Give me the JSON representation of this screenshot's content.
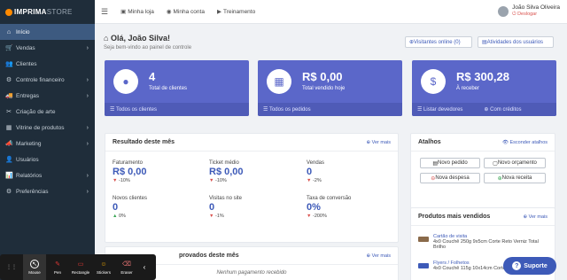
{
  "brand": {
    "name1": "IMPRIMA",
    "name2": "STORE"
  },
  "sidebar": {
    "items": [
      {
        "icon": "⌂",
        "label": "Início",
        "chev": ""
      },
      {
        "icon": "🛒",
        "label": "Vendas",
        "chev": "›"
      },
      {
        "icon": "👥",
        "label": "Clientes",
        "chev": ""
      },
      {
        "icon": "⚙",
        "label": "Controle financeiro",
        "chev": "›"
      },
      {
        "icon": "🚚",
        "label": "Entregas",
        "chev": "›"
      },
      {
        "icon": "✂",
        "label": "Criação de arte",
        "chev": ""
      },
      {
        "icon": "▦",
        "label": "Vitrine de produtos",
        "chev": "›"
      },
      {
        "icon": "📣",
        "label": "Marketing",
        "chev": "›"
      },
      {
        "icon": "👤",
        "label": "Usuários",
        "chev": ""
      },
      {
        "icon": "📊",
        "label": "Relatórios",
        "chev": "›"
      },
      {
        "icon": "⚙",
        "label": "Preferências",
        "chev": "›"
      }
    ]
  },
  "topbar": {
    "links": [
      "Minha loja",
      "Minha conta",
      "Treinamento"
    ],
    "user_name": "João Silva Oliveira",
    "logout": "Deslogar"
  },
  "greeting": {
    "title": "Olá, João Silva!",
    "subtitle": "Seja bem-vindo ao painel de controle"
  },
  "header_buttons": {
    "visitors": "Visitantes online (0)",
    "activities": "Atividades dos usuários"
  },
  "cards": [
    {
      "value": "4",
      "label": "Total de clientes",
      "footer": [
        "Todos os clientes"
      ]
    },
    {
      "value": "R$ 0,00",
      "label": "Total vendido hoje",
      "footer": [
        "Todos os pedidos"
      ]
    },
    {
      "value": "R$ 300,28",
      "label": "À receber",
      "footer": [
        "Listar devedores",
        "Com créditos"
      ]
    }
  ],
  "results": {
    "title": "Resultado deste mês",
    "link": "Ver mais",
    "metrics": [
      {
        "label": "Faturamento",
        "value": "R$ 0,00",
        "change": "-10%",
        "dir": "down"
      },
      {
        "label": "Ticket médio",
        "value": "R$ 0,00",
        "change": "-10%",
        "dir": "down"
      },
      {
        "label": "Vendas",
        "value": "0",
        "change": "-2%",
        "dir": "down"
      },
      {
        "label": "Novos clientes",
        "value": "0",
        "change": "0%",
        "dir": "up"
      },
      {
        "label": "Visitas no site",
        "value": "0",
        "change": "-1%",
        "dir": "down"
      },
      {
        "label": "Taxa de conversão",
        "value": "0%",
        "change": "-200%",
        "dir": "down"
      }
    ]
  },
  "shortcuts": {
    "title": "Atalhos",
    "hide": "Esconder atalhos",
    "buttons": [
      "Novo pedido",
      "Novo orçamento",
      "Nova despesa",
      "Nova receita"
    ]
  },
  "bestsellers": {
    "title": "Produtos mais vendidos",
    "link": "Ver mais",
    "items": [
      {
        "name": "Cartão de visita",
        "desc": "4x0 Couchê 250g 9x5cm Corte Reto Verniz Total Brilho"
      },
      {
        "name": "Flyers / Folhetos",
        "desc": "4x0 Couchê 115g 10x14cm Corte Reto Verniz"
      }
    ]
  },
  "pending": {
    "title": "provados deste mês",
    "link": "Ver mais",
    "empty": "Nenhum pagamento recebido"
  },
  "toolbar": {
    "items": [
      "Mouse",
      "Pen",
      "Rectangle",
      "Stickers",
      "Eraser"
    ]
  },
  "support": "Suporte"
}
